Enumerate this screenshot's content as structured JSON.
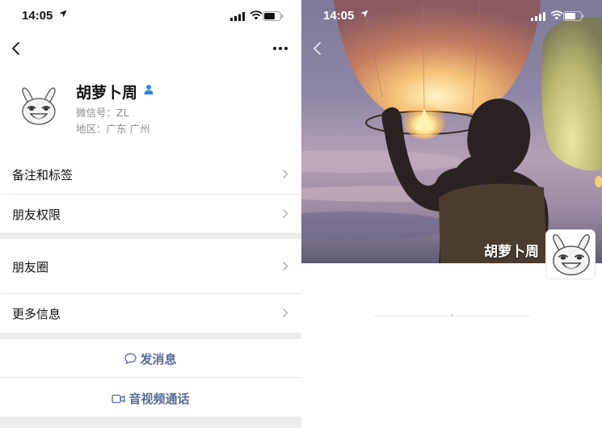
{
  "left": {
    "status_bar": {
      "time": "14:05"
    },
    "profile": {
      "name": "胡萝卜周",
      "wechat_id": "微信号：ZL",
      "region": "地区：广东 广州"
    },
    "menu": {
      "remarks_tags": "备注和标签",
      "friend_permissions": "朋友权限",
      "moments": "朋友圈",
      "more_info": "更多信息"
    },
    "actions": {
      "send_message": "发消息",
      "av_call": "音视频通话"
    }
  },
  "right": {
    "status_bar": {
      "time": "14:05"
    },
    "cover_name": "胡萝卜周"
  },
  "colors": {
    "link_blue": "#576b95",
    "background_gray": "#ededed",
    "gender_icon": "#2e8bd8"
  },
  "icons": [
    "location-arrow-icon",
    "signal-icon",
    "wifi-icon",
    "battery-icon",
    "back-icon",
    "more-icon",
    "gender-male-icon",
    "chevron-right-icon",
    "chat-bubble-icon",
    "video-camera-icon"
  ]
}
